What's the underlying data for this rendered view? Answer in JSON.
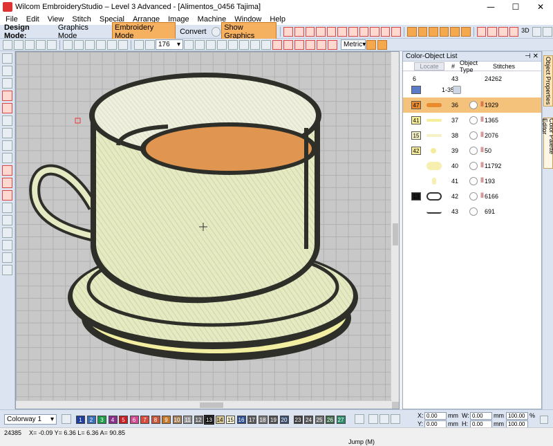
{
  "window": {
    "title": "Wilcom EmbroideryStudio – Level 3 Advanced - [Alimentos_0456          Tajima]",
    "minimize": "—",
    "maximize": "☐",
    "close": "✕"
  },
  "menu": [
    "File",
    "Edit",
    "View",
    "Stitch",
    "Special",
    "Arrange",
    "Image",
    "Machine",
    "Window",
    "Help"
  ],
  "toolbar": {
    "design_mode_label": "Design Mode:",
    "graphics_mode": "Graphics Mode",
    "embroidery_mode": "Embroidery Mode",
    "convert": "Convert",
    "show_graphics": "Show Graphics",
    "zoom_value": "176",
    "units": "Metric",
    "three_d": "3D"
  },
  "panel": {
    "title": "Color-Object List",
    "locate": "Locate",
    "col_num": "#",
    "col_type": "Object Type",
    "col_stitches": "Stitches",
    "summary": {
      "count": "6",
      "objects": "43",
      "stitches": "24262"
    },
    "group_range": "1-35",
    "rows": [
      {
        "color": "47",
        "num": "36",
        "stitches": "1929",
        "swatch": "#e98a2e"
      },
      {
        "color": "41",
        "num": "37",
        "stitches": "1365",
        "swatch": "#f6ef9a"
      },
      {
        "color": "15",
        "num": "38",
        "stitches": "2076",
        "swatch": "#f6f2c8"
      },
      {
        "color": "42",
        "num": "39",
        "stitches": "50",
        "swatch": "#f4ec9b"
      },
      {
        "color": "",
        "num": "40",
        "stitches": "11792",
        "swatch": ""
      },
      {
        "color": "",
        "num": "41",
        "stitches": "193",
        "swatch": ""
      },
      {
        "color": "13",
        "num": "42",
        "stitches": "6166",
        "swatch": "#1a1a1a"
      },
      {
        "color": "",
        "num": "43",
        "stitches": "691",
        "swatch": ""
      }
    ]
  },
  "side_tabs": {
    "object_properties": "Object Properties",
    "color_palette": "Color Palette Editor"
  },
  "colorway": "Colorway 1",
  "palette": [
    {
      "n": "1",
      "c": "#1f3f9e"
    },
    {
      "n": "2",
      "c": "#3a6fb8"
    },
    {
      "n": "3",
      "c": "#1e9c4a"
    },
    {
      "n": "4",
      "c": "#8b2f8d"
    },
    {
      "n": "5",
      "c": "#c81e26"
    },
    {
      "n": "6",
      "c": "#d04b8f"
    },
    {
      "n": "7",
      "c": "#d54c3c"
    },
    {
      "n": "8",
      "c": "#c8583c"
    },
    {
      "n": "9",
      "c": "#c37a2c"
    },
    {
      "n": "10",
      "c": "#a48058"
    },
    {
      "n": "11",
      "c": "#9a9a9a"
    },
    {
      "n": "12",
      "c": "#6d6d6d"
    },
    {
      "n": "13",
      "c": "#111111"
    },
    {
      "n": "14",
      "c": "#d9c998"
    },
    {
      "n": "15",
      "c": "#f7f3d6"
    },
    {
      "n": "16",
      "c": "#2b4d8f"
    },
    {
      "n": "17",
      "c": "#5a5a5a"
    },
    {
      "n": "18",
      "c": "#777777"
    },
    {
      "n": "19",
      "c": "#4f4f4f"
    },
    {
      "n": "20",
      "c": "#3c4d6e"
    },
    {
      "n": "23",
      "c": "#3f3f3f"
    },
    {
      "n": "24",
      "c": "#545454"
    },
    {
      "n": "25",
      "c": "#6a6a6a"
    },
    {
      "n": "26",
      "c": "#3d6a4a"
    },
    {
      "n": "27",
      "c": "#2a8a6a"
    }
  ],
  "coords": {
    "x_label": "X:",
    "y_label": "Y:",
    "w_label": "W:",
    "h_label": "H:",
    "x": "0.00",
    "y": "0.00",
    "w": "0.00",
    "h": "0.00",
    "unit": "mm",
    "pct1": "100.00",
    "pct2": "100.00",
    "pct_sign": "%"
  },
  "status": {
    "stitch_count": "24385",
    "coords": "X= -0.09 Y= 6.36 L= 6.36 A= 90.85",
    "mode": "Jump (M)"
  }
}
